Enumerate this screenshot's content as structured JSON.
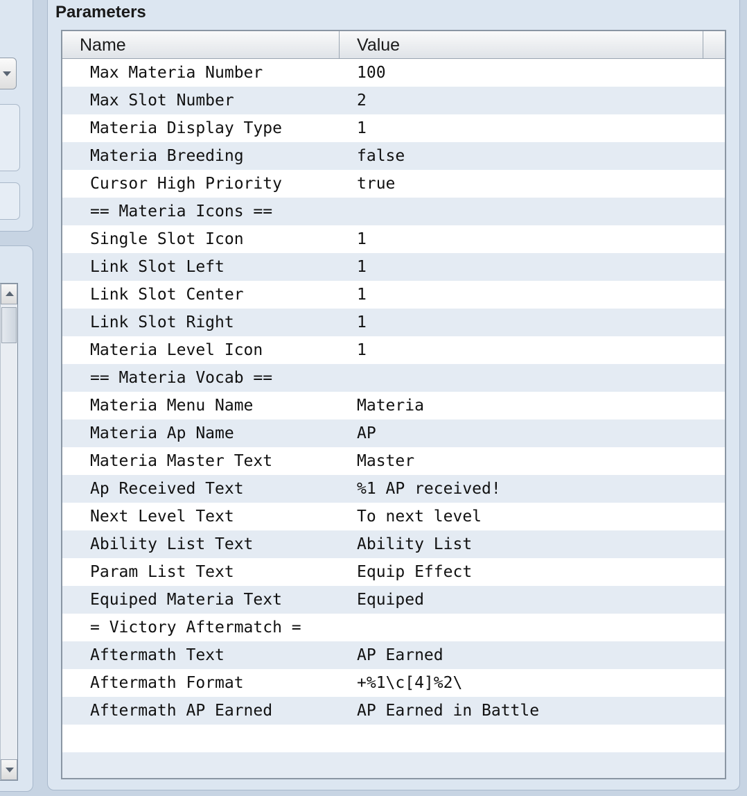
{
  "panel": {
    "title": "Parameters"
  },
  "table": {
    "columns": [
      "Name",
      "Value"
    ],
    "rows": [
      {
        "name": "Max Materia Number",
        "value": "100"
      },
      {
        "name": "Max Slot Number",
        "value": "2"
      },
      {
        "name": "Materia Display Type",
        "value": "1"
      },
      {
        "name": "Materia Breeding",
        "value": "false"
      },
      {
        "name": "Cursor High Priority",
        "value": "true"
      },
      {
        "name": "== Materia Icons ==",
        "value": ""
      },
      {
        "name": "Single Slot Icon",
        "value": "1"
      },
      {
        "name": "Link Slot Left",
        "value": "1"
      },
      {
        "name": "Link Slot Center",
        "value": "1"
      },
      {
        "name": "Link Slot Right",
        "value": "1"
      },
      {
        "name": "Materia Level Icon",
        "value": "1"
      },
      {
        "name": "== Materia Vocab ==",
        "value": ""
      },
      {
        "name": "Materia Menu Name",
        "value": "Materia"
      },
      {
        "name": "Materia Ap Name",
        "value": "AP"
      },
      {
        "name": "Materia Master Text",
        "value": "Master"
      },
      {
        "name": "Ap Received Text",
        "value": "%1 AP received!"
      },
      {
        "name": "Next Level Text",
        "value": "To next level"
      },
      {
        "name": "Ability List Text",
        "value": "Ability List"
      },
      {
        "name": "Param List Text",
        "value": "Equip Effect"
      },
      {
        "name": "Equiped Materia Text",
        "value": "Equiped"
      },
      {
        "name": "= Victory Aftermatch =",
        "value": ""
      },
      {
        "name": "Aftermath Text",
        "value": "AP Earned"
      },
      {
        "name": "Aftermath Format",
        "value": "+%1\\c[4]%2\\"
      },
      {
        "name": "Aftermath AP Earned",
        "value": "AP Earned in Battle"
      },
      {
        "name": "",
        "value": ""
      },
      {
        "name": "",
        "value": ""
      }
    ]
  },
  "icons": {
    "dropdown": "chevron-down-icon",
    "scroll_up": "scroll-up-arrow-icon",
    "scroll_down": "scroll-down-arrow-icon"
  }
}
